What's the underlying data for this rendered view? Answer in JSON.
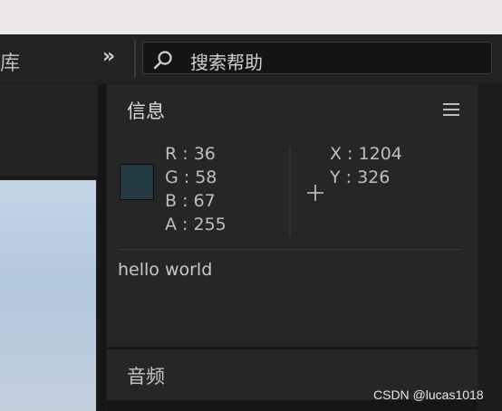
{
  "toolbar": {
    "library_label": "库",
    "expand_label": "»",
    "search": {
      "value": "搜索帮助"
    }
  },
  "info_panel": {
    "title": "信息",
    "swatch_color": "#243a43",
    "color_values": {
      "r": {
        "label": "R :",
        "value": "36"
      },
      "g": {
        "label": "G :",
        "value": "58"
      },
      "b": {
        "label": "B :",
        "value": "67"
      },
      "a": {
        "label": "A :",
        "value": "255"
      }
    },
    "position": {
      "x": {
        "label": "X :",
        "value": "1204"
      },
      "y": {
        "label": "Y :",
        "value": "326"
      }
    },
    "text": "hello world"
  },
  "audio_panel": {
    "title": "音频"
  },
  "watermark": "CSDN @lucas1018"
}
